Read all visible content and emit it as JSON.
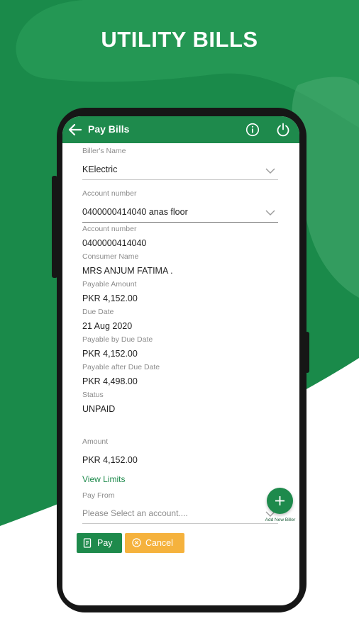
{
  "banner": {
    "headline": "UTILITY BILLS"
  },
  "colors": {
    "brand_green": "#1e8a4c",
    "cancel_orange": "#f5b23d"
  },
  "appbar": {
    "title": "Pay Bills",
    "back_icon": "arrow-left-icon",
    "info_icon": "info-icon",
    "power_icon": "power-icon"
  },
  "form": {
    "biller": {
      "label": "Biller's Name",
      "value": "KElectric"
    },
    "account_select": {
      "label": "Account number",
      "value": "0400000414040 anas floor"
    }
  },
  "details": [
    {
      "label": "Account number",
      "value": "0400000414040"
    },
    {
      "label": "Consumer Name",
      "value": "MRS ANJUM FATIMA ."
    },
    {
      "label": "Payable Amount",
      "value": "PKR 4,152.00"
    },
    {
      "label": "Due Date",
      "value": "21 Aug 2020"
    },
    {
      "label": "Payable by Due Date",
      "value": "PKR 4,152.00"
    },
    {
      "label": "Payable after Due Date",
      "value": "PKR 4,498.00"
    },
    {
      "label": "Status",
      "value": "UNPAID"
    }
  ],
  "amount": {
    "label": "Amount",
    "value": "PKR 4,152.00"
  },
  "view_limits": "View Limits",
  "pay_from": {
    "label": "Pay From",
    "placeholder": "Please Select an account...."
  },
  "fab": {
    "label": "Add New Biller"
  },
  "buttons": {
    "pay": "Pay",
    "cancel": "Cancel"
  }
}
